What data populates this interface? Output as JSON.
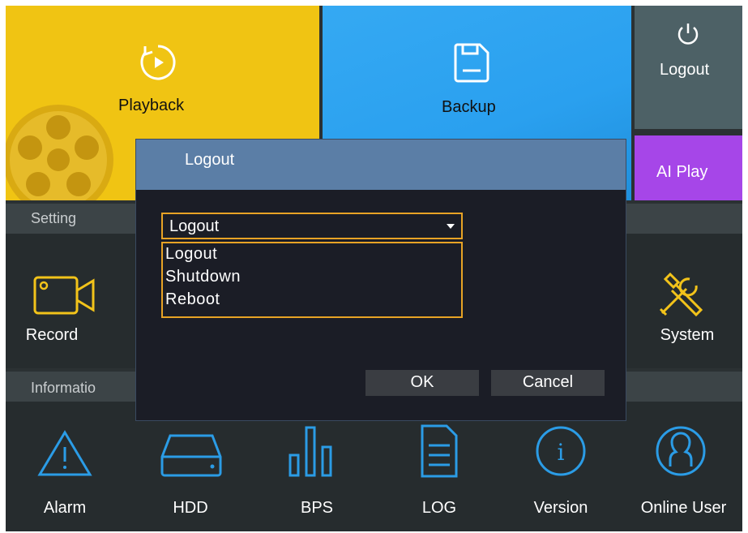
{
  "tiles": {
    "playback": "Playback",
    "backup": "Backup",
    "logout": "Logout",
    "ai_play": "AI Play"
  },
  "setting": {
    "title": "Setting",
    "apps": {
      "record": "Record",
      "system": "System"
    }
  },
  "information": {
    "title": "Informatio",
    "apps": {
      "alarm": "Alarm",
      "hdd": "HDD",
      "bps": "BPS",
      "log": "LOG",
      "version": "Version",
      "online_user": "Online User"
    }
  },
  "dialog": {
    "title": "Logout",
    "selected": "Logout",
    "options": [
      "Logout",
      "Shutdown",
      "Reboot"
    ],
    "ok": "OK",
    "cancel": "Cancel"
  },
  "colors": {
    "playback_tile": "#f0c413",
    "backup_tile": "#2aa3f1",
    "logout_tile": "#4d6166",
    "ai_play_tile": "#a646e8",
    "icon_yellow": "#f2c31a",
    "icon_blue": "#2b9ce6",
    "dropdown_border": "#e8a325",
    "dialog_titlebar": "#5b7ea6"
  }
}
